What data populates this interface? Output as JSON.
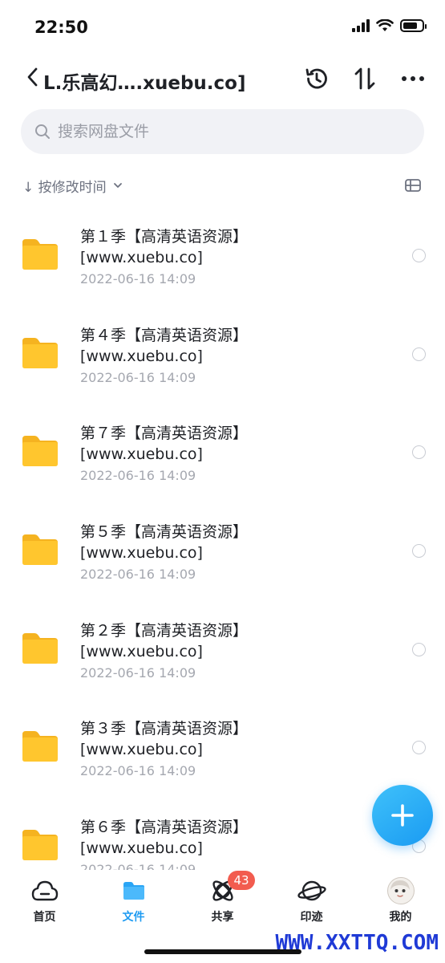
{
  "status_bar": {
    "time": "22:50",
    "icons": [
      "cellular-signal-icon",
      "wifi-icon",
      "battery-icon"
    ]
  },
  "header": {
    "title": "L.乐高幻….xuebu.co]",
    "icons": [
      "chevron-left-icon",
      "history-clock-icon",
      "sort-arrows-icon",
      "more-dots-icon"
    ]
  },
  "search": {
    "placeholder": "搜索网盘文件"
  },
  "sort": {
    "label": "↓ 按修改时间"
  },
  "files": [
    {
      "name": "第１季【高清英语资源】[www.xuebu.co]",
      "date": "2022-06-16 14:09"
    },
    {
      "name": "第４季【高清英语资源】[www.xuebu.co]",
      "date": "2022-06-16 14:09"
    },
    {
      "name": "第７季【高清英语资源】[www.xuebu.co]",
      "date": "2022-06-16 14:09"
    },
    {
      "name": "第５季【高清英语资源】[www.xuebu.co]",
      "date": "2022-06-16 14:09"
    },
    {
      "name": "第２季【高清英语资源】[www.xuebu.co]",
      "date": "2022-06-16 14:09"
    },
    {
      "name": "第３季【高清英语资源】[www.xuebu.co]",
      "date": "2022-06-16 14:09"
    },
    {
      "name": "第６季【高清英语资源】[www.xuebu.co]",
      "date": "2022-06-16 14:09"
    }
  ],
  "tabs": [
    {
      "label": "首页",
      "icon": "cloud-home-icon"
    },
    {
      "label": "文件",
      "icon": "folder-icon",
      "active": true
    },
    {
      "label": "共享",
      "icon": "share-orbit-icon",
      "badge": "43"
    },
    {
      "label": "印迹",
      "icon": "planet-icon"
    },
    {
      "label": "我的",
      "icon": "avatar"
    }
  ],
  "watermark": "WWW.XXTTQ.COM",
  "colors": {
    "accent": "#1e9bf2",
    "folder": "#ffc62e",
    "badge": "#f25c4f",
    "watermark": "#1f3ad6"
  }
}
